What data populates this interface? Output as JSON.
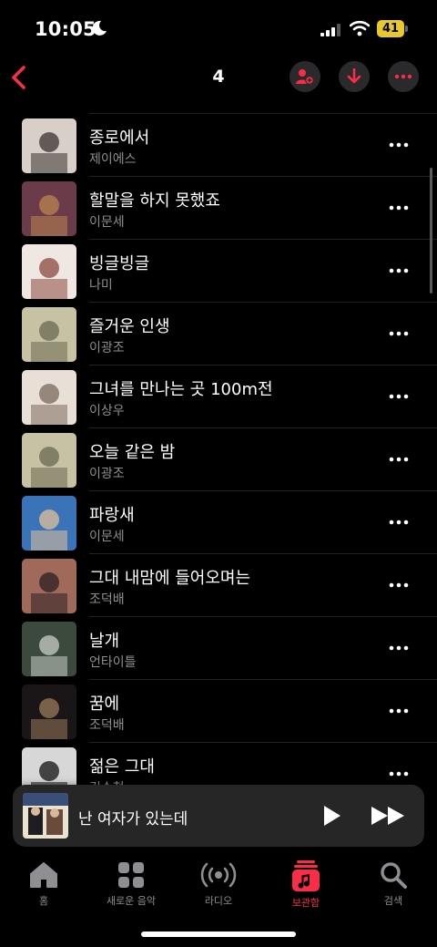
{
  "status": {
    "time": "10:05",
    "battery": "41"
  },
  "nav": {
    "title": "4"
  },
  "songs": [
    {
      "title": "종로에서",
      "artist": "제이에스",
      "art": [
        "#d8cfc8",
        "#3b3330"
      ]
    },
    {
      "title": "할말을 하지 못했죠",
      "artist": "이문세",
      "art": [
        "#6b3b4a",
        "#b9854f"
      ]
    },
    {
      "title": "빙글빙글",
      "artist": "나미",
      "art": [
        "#efe7e2",
        "#8a4a3f"
      ]
    },
    {
      "title": "즐거운 인생",
      "artist": "이광조",
      "art": [
        "#c8c2a4",
        "#6a6a52"
      ]
    },
    {
      "title": "그녀를 만나는 곳 100m전",
      "artist": "이상우",
      "art": [
        "#e8dfd6",
        "#7b6a5d"
      ]
    },
    {
      "title": "오늘 같은 밤",
      "artist": "이광조",
      "art": [
        "#c8c2a4",
        "#6a6a52"
      ]
    },
    {
      "title": "파랑새",
      "artist": "이문세",
      "art": [
        "#3a73b8",
        "#e1c29a"
      ]
    },
    {
      "title": "그대 내맘에 들어오며는",
      "artist": "조덕배",
      "art": [
        "#a06a5a",
        "#2b1f22"
      ]
    },
    {
      "title": "날개",
      "artist": "언타이틀",
      "art": [
        "#3c4a3e",
        "#c7cdc6"
      ]
    },
    {
      "title": "꿈에",
      "artist": "조덕배",
      "art": [
        "#1a1618",
        "#9a7a5a"
      ]
    },
    {
      "title": "젊은 그대",
      "artist": "김수철",
      "art": [
        "#d7d7d7",
        "#111111"
      ]
    }
  ],
  "now_playing": {
    "title": "난 여자가 있는데"
  },
  "tabs": [
    {
      "label": "홈",
      "icon": "home-icon"
    },
    {
      "label": "새로운 음악",
      "icon": "grid-icon"
    },
    {
      "label": "라디오",
      "icon": "radio-icon"
    },
    {
      "label": "보관함",
      "icon": "library-icon",
      "active": true
    },
    {
      "label": "검색",
      "icon": "search-icon"
    }
  ],
  "colors": {
    "accent": "#fa2d48",
    "background": "#000000",
    "secondary_text": "#8e8e93"
  }
}
